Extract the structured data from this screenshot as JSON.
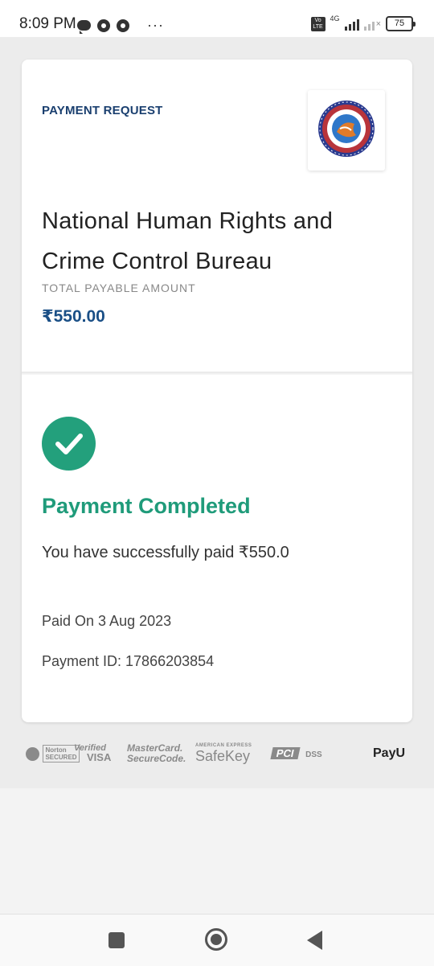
{
  "status_bar": {
    "time": "8:09 PM",
    "network": "4G",
    "volte": "Vo LTE",
    "battery": "75",
    "overflow": "···",
    "icons": [
      "chat-icon",
      "chrome-icon",
      "chrome-icon",
      "signal-icon",
      "battery-icon"
    ]
  },
  "card": {
    "request_label": "PAYMENT REQUEST",
    "logo_icon": "nhrccb-logo",
    "organization_name": "National Human Rights and Crime Control Bureau",
    "total_label": "TOTAL PAYABLE AMOUNT",
    "total_amount": "₹550.00"
  },
  "result": {
    "icon": "check-icon",
    "title": "Payment Completed",
    "message": "You have successfully paid ₹550.0",
    "paid_on": "Paid On 3 Aug 2023",
    "payment_id": "Payment ID: 17866203854"
  },
  "badges": {
    "norton": "Norton SECURED",
    "visa_line1": "Verified",
    "visa_line2": "VISA",
    "mastercard_line1": "MasterCard.",
    "mastercard_line2": "SecureCode.",
    "amex_small": "AMERICAN EXPRESS",
    "safekey": "SafeKey",
    "pci": "PCI",
    "dss": "DSS",
    "payu": "PayU"
  },
  "colors": {
    "accent_blue": "#1a3f6f",
    "amount_blue": "#1a4f86",
    "success_green": "#23a07c"
  }
}
